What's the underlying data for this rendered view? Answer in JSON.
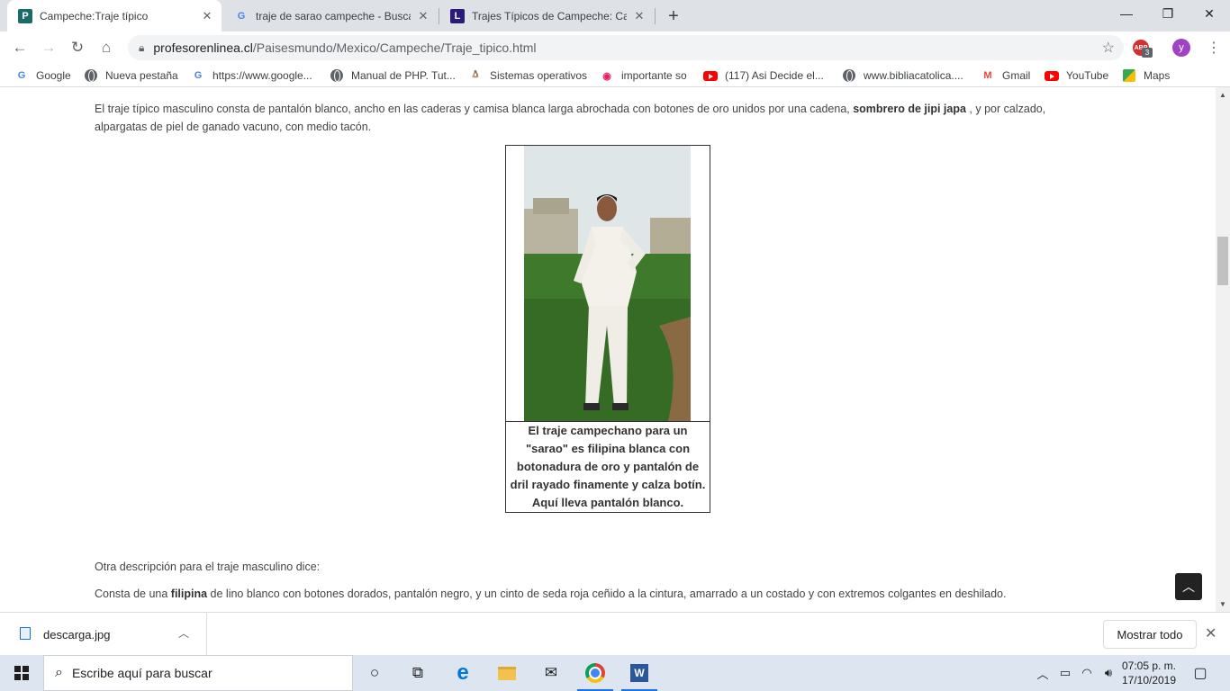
{
  "browser": {
    "tabs": [
      {
        "title": "Campeche:Traje típico",
        "favicon": "P"
      },
      {
        "title": "traje de sarao campeche - Buscar",
        "favicon": "G"
      },
      {
        "title": "Trajes Típicos de Campeche: Cara",
        "favicon": "L"
      }
    ],
    "url_domain": "profesorenlinea.cl",
    "url_path": "/Paisesmundo/Mexico/Campeche/Traje_tipico.html",
    "extension_badge": "3",
    "profile_initial": "y"
  },
  "bookmarks": [
    {
      "label": "Google",
      "icon": "google-icon"
    },
    {
      "label": "Nueva pestaña",
      "icon": "globe-icon"
    },
    {
      "label": "https://www.google...",
      "icon": "google-icon"
    },
    {
      "label": "Manual de PHP. Tut...",
      "icon": "globe-icon"
    },
    {
      "label": "Sistemas operativos",
      "icon": "tux-icon"
    },
    {
      "label": "importante so",
      "icon": "lips-icon"
    },
    {
      "label": "(117) Asi Decide el...",
      "icon": "youtube-icon"
    },
    {
      "label": "www.bibliacatolica....",
      "icon": "globe-icon"
    },
    {
      "label": "Gmail",
      "icon": "gmail-icon"
    },
    {
      "label": "YouTube",
      "icon": "youtube-icon"
    },
    {
      "label": "Maps",
      "icon": "maps-icon"
    }
  ],
  "content": {
    "para1_a": "El traje típico masculino consta de pantalón blanco, ancho en las caderas y camisa blanca larga abrochada con botones de oro unidos por una cadena, ",
    "para1_bold": "sombrero de jipi japa",
    "para1_b": " , y por calzado, alpargatas de piel de ganado vacuno, con medio tacón.",
    "caption": "El traje campechano para un \"sarao\" es filipina blanca con botonadura de oro y pantalón de dril rayado finamente y calza botín. Aquí lleva pantalón blanco.",
    "para2": "Otra descripción para el traje masculino dice:",
    "para3_a": "Consta de una ",
    "para3_bold": "filipina",
    "para3_b": " de lino blanco con botones dorados, pantalón negro, y un cinto de seda roja ceñido a la cintura, amarrado a un costado y con extremos colgantes en deshilado."
  },
  "downloads": {
    "filename": "descarga.jpg",
    "show_all": "Mostrar todo"
  },
  "taskbar": {
    "search_placeholder": "Escribe aquí para buscar",
    "time": "07:05 p. m.",
    "date": "17/10/2019"
  },
  "colors": {
    "tabstrip": "#dee1e6",
    "taskbar": "#dde6f0",
    "text": "#444444"
  }
}
